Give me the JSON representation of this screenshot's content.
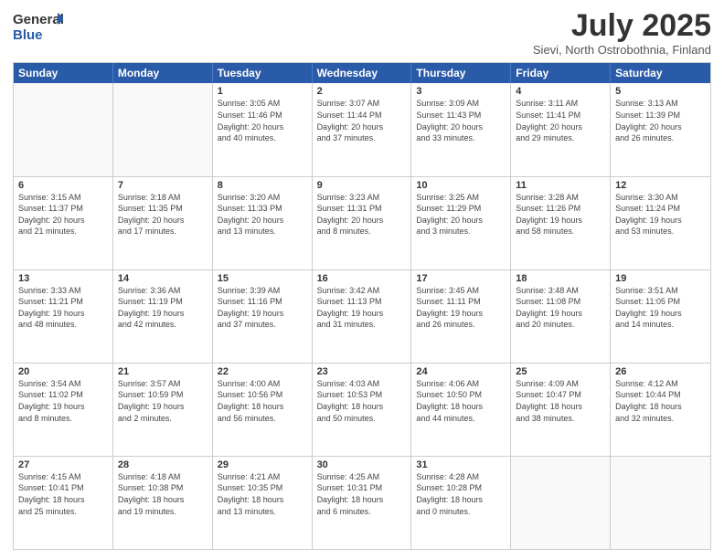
{
  "logo": {
    "line1": "General",
    "line2": "Blue"
  },
  "header": {
    "title": "July 2025",
    "subtitle": "Sievi, North Ostrobothnia, Finland"
  },
  "weekdays": [
    "Sunday",
    "Monday",
    "Tuesday",
    "Wednesday",
    "Thursday",
    "Friday",
    "Saturday"
  ],
  "weeks": [
    [
      {
        "day": "",
        "info": ""
      },
      {
        "day": "",
        "info": ""
      },
      {
        "day": "1",
        "info": "Sunrise: 3:05 AM\nSunset: 11:46 PM\nDaylight: 20 hours\nand 40 minutes."
      },
      {
        "day": "2",
        "info": "Sunrise: 3:07 AM\nSunset: 11:44 PM\nDaylight: 20 hours\nand 37 minutes."
      },
      {
        "day": "3",
        "info": "Sunrise: 3:09 AM\nSunset: 11:43 PM\nDaylight: 20 hours\nand 33 minutes."
      },
      {
        "day": "4",
        "info": "Sunrise: 3:11 AM\nSunset: 11:41 PM\nDaylight: 20 hours\nand 29 minutes."
      },
      {
        "day": "5",
        "info": "Sunrise: 3:13 AM\nSunset: 11:39 PM\nDaylight: 20 hours\nand 26 minutes."
      }
    ],
    [
      {
        "day": "6",
        "info": "Sunrise: 3:15 AM\nSunset: 11:37 PM\nDaylight: 20 hours\nand 21 minutes."
      },
      {
        "day": "7",
        "info": "Sunrise: 3:18 AM\nSunset: 11:35 PM\nDaylight: 20 hours\nand 17 minutes."
      },
      {
        "day": "8",
        "info": "Sunrise: 3:20 AM\nSunset: 11:33 PM\nDaylight: 20 hours\nand 13 minutes."
      },
      {
        "day": "9",
        "info": "Sunrise: 3:23 AM\nSunset: 11:31 PM\nDaylight: 20 hours\nand 8 minutes."
      },
      {
        "day": "10",
        "info": "Sunrise: 3:25 AM\nSunset: 11:29 PM\nDaylight: 20 hours\nand 3 minutes."
      },
      {
        "day": "11",
        "info": "Sunrise: 3:28 AM\nSunset: 11:26 PM\nDaylight: 19 hours\nand 58 minutes."
      },
      {
        "day": "12",
        "info": "Sunrise: 3:30 AM\nSunset: 11:24 PM\nDaylight: 19 hours\nand 53 minutes."
      }
    ],
    [
      {
        "day": "13",
        "info": "Sunrise: 3:33 AM\nSunset: 11:21 PM\nDaylight: 19 hours\nand 48 minutes."
      },
      {
        "day": "14",
        "info": "Sunrise: 3:36 AM\nSunset: 11:19 PM\nDaylight: 19 hours\nand 42 minutes."
      },
      {
        "day": "15",
        "info": "Sunrise: 3:39 AM\nSunset: 11:16 PM\nDaylight: 19 hours\nand 37 minutes."
      },
      {
        "day": "16",
        "info": "Sunrise: 3:42 AM\nSunset: 11:13 PM\nDaylight: 19 hours\nand 31 minutes."
      },
      {
        "day": "17",
        "info": "Sunrise: 3:45 AM\nSunset: 11:11 PM\nDaylight: 19 hours\nand 26 minutes."
      },
      {
        "day": "18",
        "info": "Sunrise: 3:48 AM\nSunset: 11:08 PM\nDaylight: 19 hours\nand 20 minutes."
      },
      {
        "day": "19",
        "info": "Sunrise: 3:51 AM\nSunset: 11:05 PM\nDaylight: 19 hours\nand 14 minutes."
      }
    ],
    [
      {
        "day": "20",
        "info": "Sunrise: 3:54 AM\nSunset: 11:02 PM\nDaylight: 19 hours\nand 8 minutes."
      },
      {
        "day": "21",
        "info": "Sunrise: 3:57 AM\nSunset: 10:59 PM\nDaylight: 19 hours\nand 2 minutes."
      },
      {
        "day": "22",
        "info": "Sunrise: 4:00 AM\nSunset: 10:56 PM\nDaylight: 18 hours\nand 56 minutes."
      },
      {
        "day": "23",
        "info": "Sunrise: 4:03 AM\nSunset: 10:53 PM\nDaylight: 18 hours\nand 50 minutes."
      },
      {
        "day": "24",
        "info": "Sunrise: 4:06 AM\nSunset: 10:50 PM\nDaylight: 18 hours\nand 44 minutes."
      },
      {
        "day": "25",
        "info": "Sunrise: 4:09 AM\nSunset: 10:47 PM\nDaylight: 18 hours\nand 38 minutes."
      },
      {
        "day": "26",
        "info": "Sunrise: 4:12 AM\nSunset: 10:44 PM\nDaylight: 18 hours\nand 32 minutes."
      }
    ],
    [
      {
        "day": "27",
        "info": "Sunrise: 4:15 AM\nSunset: 10:41 PM\nDaylight: 18 hours\nand 25 minutes."
      },
      {
        "day": "28",
        "info": "Sunrise: 4:18 AM\nSunset: 10:38 PM\nDaylight: 18 hours\nand 19 minutes."
      },
      {
        "day": "29",
        "info": "Sunrise: 4:21 AM\nSunset: 10:35 PM\nDaylight: 18 hours\nand 13 minutes."
      },
      {
        "day": "30",
        "info": "Sunrise: 4:25 AM\nSunset: 10:31 PM\nDaylight: 18 hours\nand 6 minutes."
      },
      {
        "day": "31",
        "info": "Sunrise: 4:28 AM\nSunset: 10:28 PM\nDaylight: 18 hours\nand 0 minutes."
      },
      {
        "day": "",
        "info": ""
      },
      {
        "day": "",
        "info": ""
      }
    ]
  ]
}
